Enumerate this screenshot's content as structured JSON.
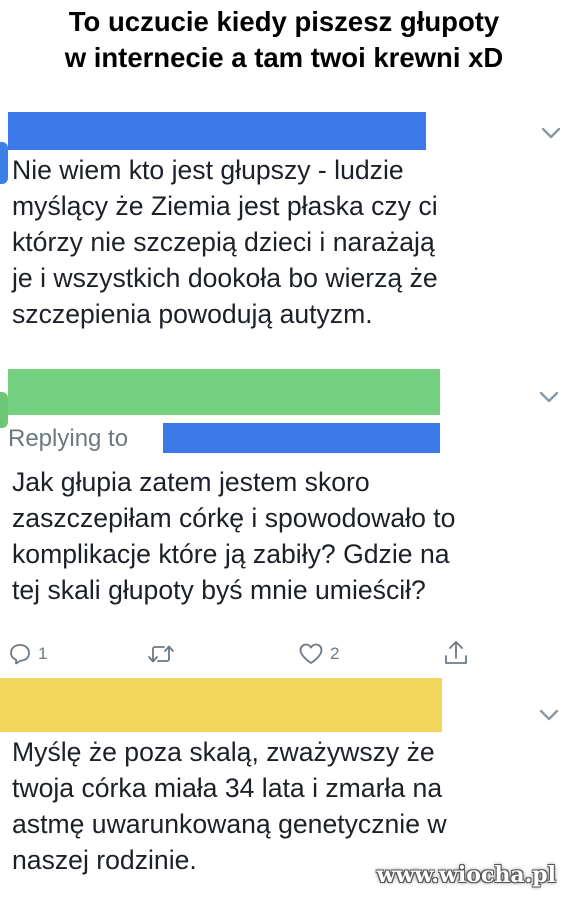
{
  "meme": {
    "title_line1": "To uczucie kiedy piszesz głupoty",
    "title_line2": "w internecie a tam twoi krewni xD"
  },
  "tweet1": {
    "redaction_color": "#3b79e8",
    "lines": [
      "Nie wiem kto jest głupszy - ludzie",
      "myślący że Ziemia jest płaska czy ci",
      "którzy nie szczepią dzieci i narażają",
      "je i wszystkich dookoła bo wierzą że",
      "szczepienia powodują autyzm."
    ],
    "menu_icon": "chevron-down-icon"
  },
  "tweet2": {
    "redaction_color": "#72d07e",
    "replying_label": "Replying to",
    "replying_redaction_color": "#3b79e8",
    "lines": [
      "Jak głupia zatem jestem skoro",
      "zaszczepiłam córkę i spowodowało to",
      "komplikacje które ją zabiły? Gdzie na",
      "tej skali głupoty byś mnie umieścił?"
    ],
    "actions": {
      "reply_count": "1",
      "retweet_count": "",
      "like_count": "2"
    },
    "menu_icon": "chevron-down-icon"
  },
  "tweet3": {
    "redaction_color": "#f2d55c",
    "lines": [
      "Myślę że poza skalą, zważywszy że",
      "twoja córka miała 34 lata i zmarła na",
      "astmę uwarunkowaną genetycznie w",
      "naszej rodzinie."
    ],
    "menu_icon": "chevron-down-icon"
  },
  "watermark": "www.wiocha.pl",
  "colors": {
    "text": "#1c2027",
    "muted": "#6c7983",
    "divider": "#e6ecf0"
  }
}
